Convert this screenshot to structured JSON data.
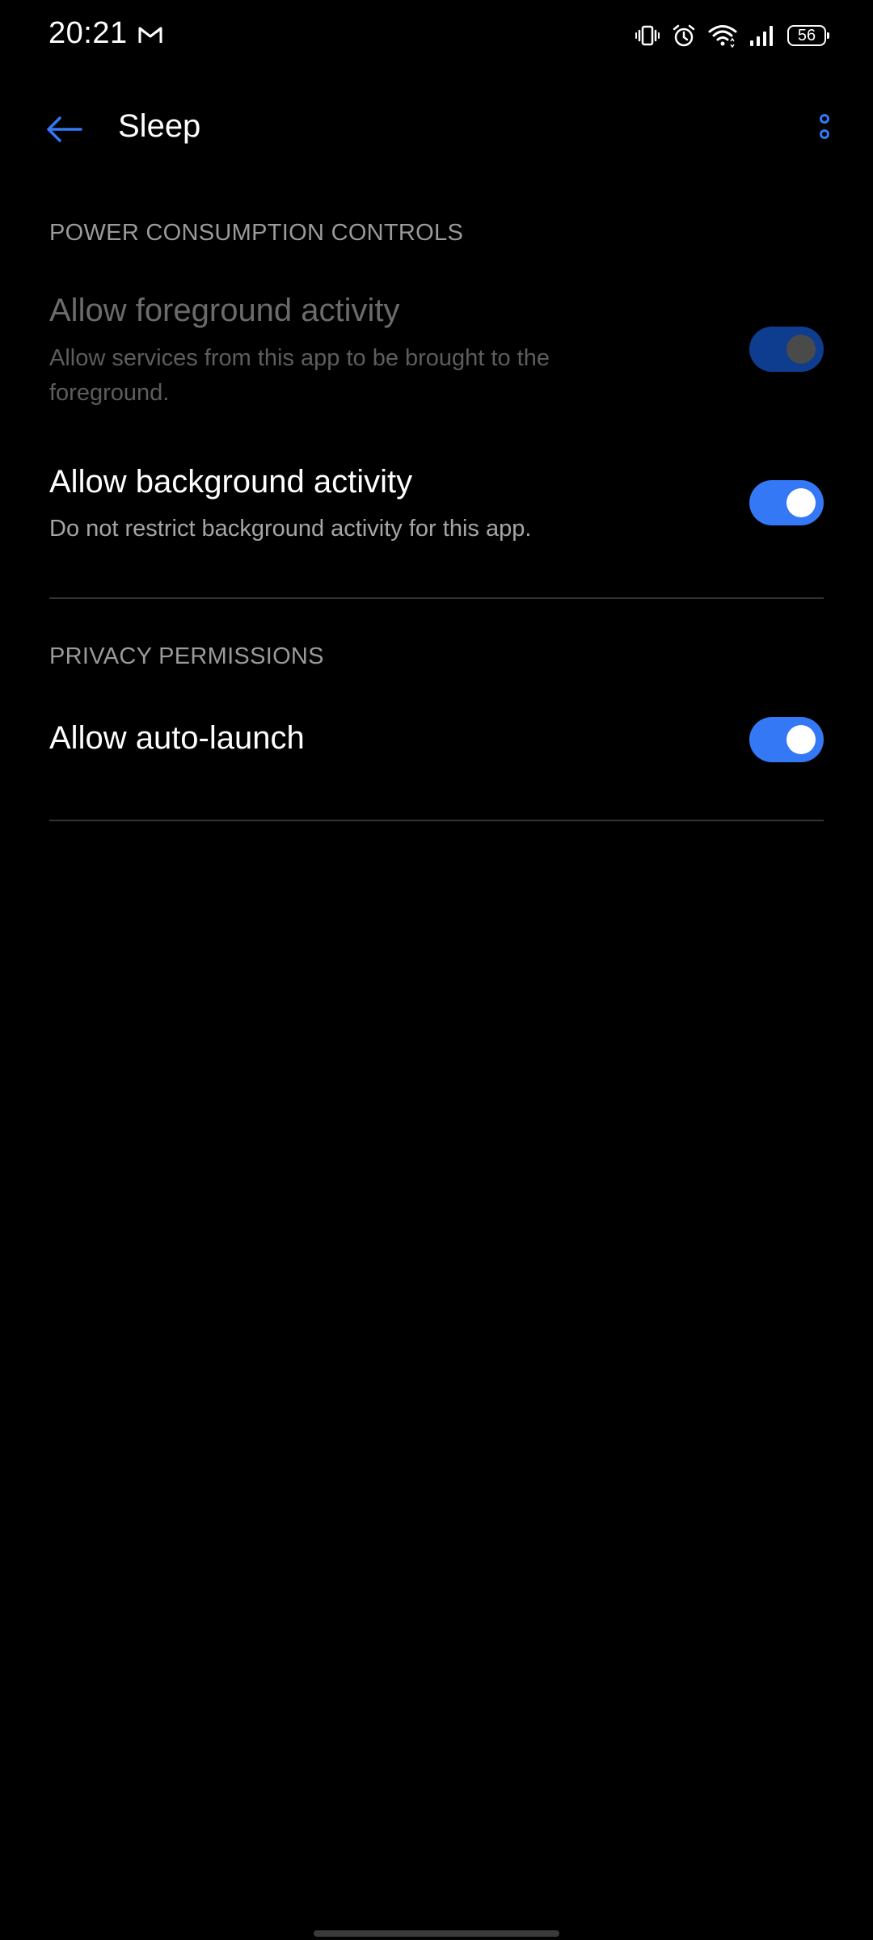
{
  "status_bar": {
    "time": "20:21",
    "notification_icon": "gmail-icon",
    "battery_level": "56",
    "icons": [
      "vibrate-icon",
      "alarm-icon",
      "wifi-icon",
      "signal-icon",
      "battery-icon"
    ]
  },
  "app_bar": {
    "title": "Sleep",
    "back_icon": "back-arrow-icon",
    "menu_icon": "more-options-icon"
  },
  "sections": {
    "power": {
      "header": "POWER CONSUMPTION CONTROLS",
      "foreground": {
        "title": "Allow foreground activity",
        "description": "Allow services from this app to be brought to the foreground.",
        "enabled": true,
        "disabled_state": true
      },
      "background": {
        "title": "Allow background activity",
        "description": "Do not restrict background activity for this app.",
        "enabled": true
      }
    },
    "privacy": {
      "header": "PRIVACY PERMISSIONS",
      "auto_launch": {
        "title": "Allow auto-launch",
        "enabled": true
      }
    }
  },
  "colors": {
    "accent": "#3478f6",
    "accent_disabled": "#0e3c8f",
    "background": "#000000",
    "section_header": "#9a9a9a"
  }
}
